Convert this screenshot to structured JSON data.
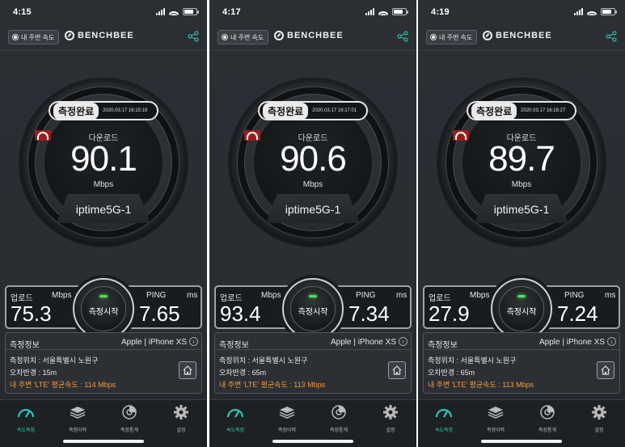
{
  "screens": [
    {
      "status_time": "4:15",
      "header": {
        "nearby_label": "내 주변 속도",
        "brand": "BENCHBEE"
      },
      "gauge": {
        "badge": "측정완료",
        "date": "2020.03.17 16:15:19",
        "download_label": "다운로드",
        "download_value": "90.1",
        "unit": "Mbps",
        "ssid": "iptime5G-1"
      },
      "results": {
        "upload_label": "업로드",
        "upload_unit": "Mbps",
        "upload_value": "75.3",
        "ping_label": "PING",
        "ping_unit": "ms",
        "ping_value": "7.65",
        "start_label": "측정시작"
      },
      "info": {
        "title": "측정정보",
        "device": "Apple | iPhone XS",
        "location": "측정위치 : 서울특별시 노원구",
        "radius": "오차반경 : 15m",
        "avg": "내 주변 'LTE' 평균속도 : 114 Mbps"
      },
      "tabs": [
        "속도측정",
        "측정이력",
        "측정통계",
        "설정"
      ]
    },
    {
      "status_time": "4:17",
      "header": {
        "nearby_label": "내 주변 속도",
        "brand": "BENCHBEE"
      },
      "gauge": {
        "badge": "측정완료",
        "date": "2020.03.17 16:17:01",
        "download_label": "다운로드",
        "download_value": "90.6",
        "unit": "Mbps",
        "ssid": "iptime5G-1"
      },
      "results": {
        "upload_label": "업로드",
        "upload_unit": "Mbps",
        "upload_value": "93.4",
        "ping_label": "PING",
        "ping_unit": "ms",
        "ping_value": "7.34",
        "start_label": "측정시작"
      },
      "info": {
        "title": "측정정보",
        "device": "Apple | iPhone XS",
        "location": "측정위치 : 서울특별시 노원구",
        "radius": "오차반경 : 65m",
        "avg": "내 주변 'LTE' 평균속도 : 113 Mbps"
      },
      "tabs": [
        "속도측정",
        "측정이력",
        "측정통계",
        "설정"
      ]
    },
    {
      "status_time": "4:19",
      "header": {
        "nearby_label": "내 주변 속도",
        "brand": "BENCHBEE"
      },
      "gauge": {
        "badge": "측정완료",
        "date": "2020.03.17 16:18:27",
        "download_label": "다운로드",
        "download_value": "89.7",
        "unit": "Mbps",
        "ssid": "iptime5G-1"
      },
      "results": {
        "upload_label": "업로드",
        "upload_unit": "Mbps",
        "upload_value": "27.9",
        "ping_label": "PING",
        "ping_unit": "ms",
        "ping_value": "7.24",
        "start_label": "측정시작"
      },
      "info": {
        "title": "측정정보",
        "device": "Apple | iPhone XS",
        "location": "측정위치 : 서울특별시 노원구",
        "radius": "오차반경 : 65m",
        "avg": "내 주변 'LTE' 평균속도 : 113 Mbps"
      },
      "tabs": [
        "속도측정",
        "측정이력",
        "측정통계",
        "설정"
      ]
    }
  ],
  "icons": {
    "share": "share-icon",
    "home": "home-icon",
    "speedometer": "speedometer-icon",
    "layers": "history-icon",
    "chart": "stats-icon",
    "gear": "gear-icon"
  },
  "colors": {
    "accent": "#2ad0c3",
    "warning": "#f29a3a",
    "wifi_badge": "#9b1c1c",
    "start_led": "#4be35a"
  }
}
